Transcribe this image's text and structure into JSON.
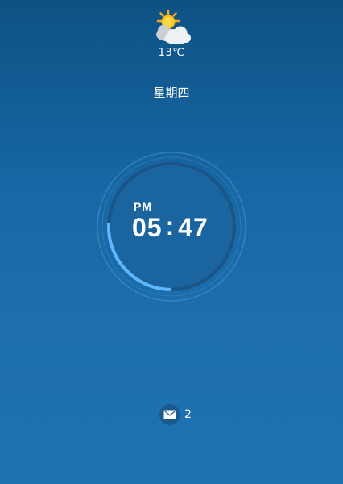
{
  "weather": {
    "icon": "partly-sunny-icon",
    "temperature": "13℃"
  },
  "date": {
    "weekday": "星期四"
  },
  "clock": {
    "ampm": "PM",
    "hours": "05",
    "separator": ":",
    "minutes": "47",
    "progress_color": "#5eb8ff"
  },
  "messages": {
    "icon": "envelope-icon",
    "count": "2"
  }
}
